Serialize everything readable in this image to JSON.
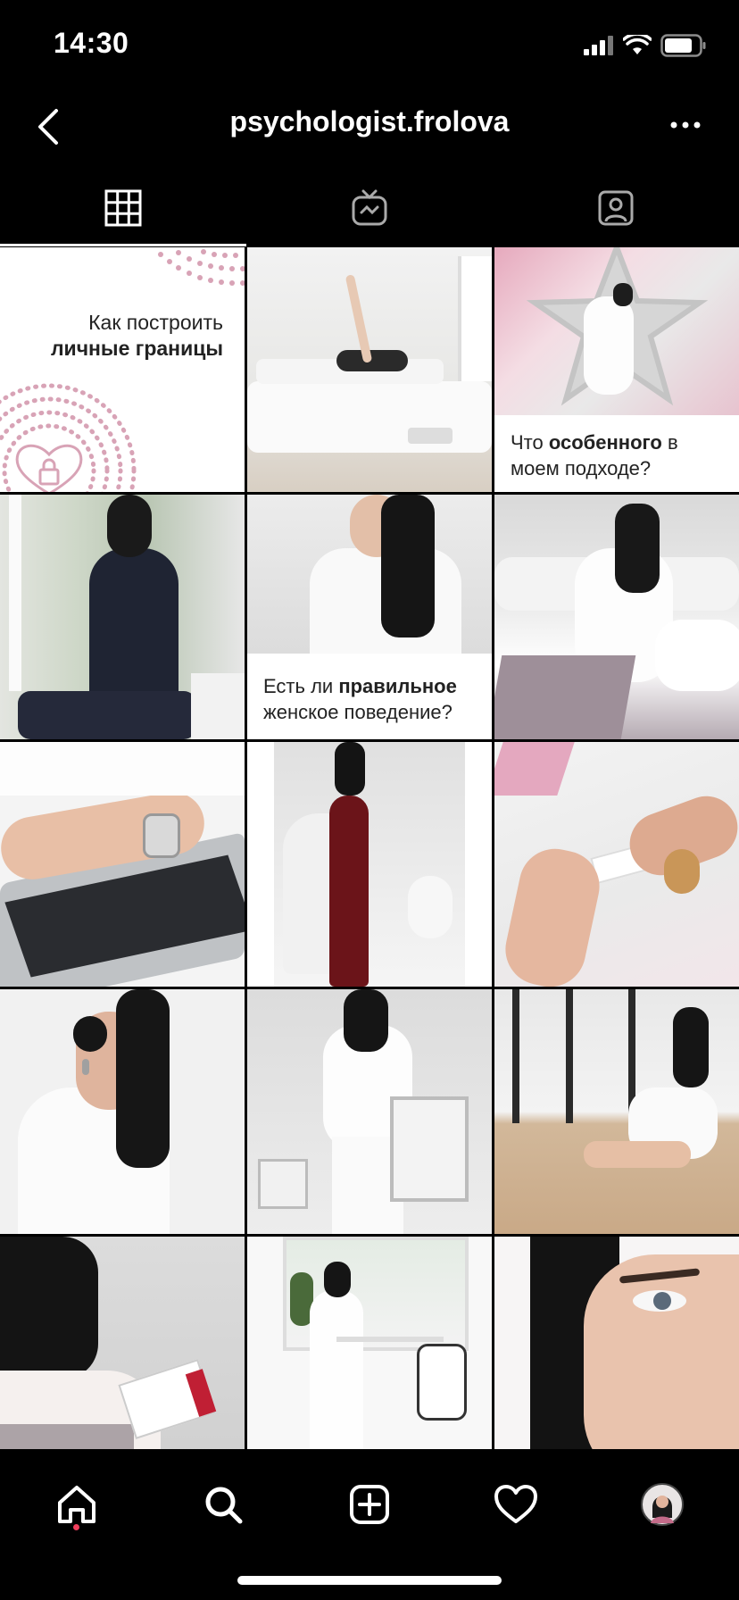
{
  "status": {
    "time": "14:30"
  },
  "header": {
    "title": "psychologist.frolova"
  },
  "tabs": [
    {
      "name": "grid",
      "icon": "grid-icon",
      "active": true
    },
    {
      "name": "igtv",
      "icon": "tv-icon",
      "active": false
    },
    {
      "name": "tagged",
      "icon": "tagged-icon",
      "active": false
    }
  ],
  "posts": [
    {
      "type": "text-card",
      "line1": "Как построить",
      "line2": "личные границы"
    },
    {
      "type": "photo",
      "subject": "woman lying on bed reading"
    },
    {
      "type": "photo-caption",
      "caption_pre": "Что ",
      "caption_bold": "особенного",
      "caption_post": " в",
      "caption_line2": "моем подходе?"
    },
    {
      "type": "photo",
      "subject": "woman in black dress by window"
    },
    {
      "type": "photo-caption",
      "caption_pre": "Есть ли ",
      "caption_bold": "правильное",
      "caption_post": "",
      "caption_line2": "женское поведение?"
    },
    {
      "type": "photo",
      "subject": "woman in white on bed with mug"
    },
    {
      "type": "photo",
      "subject": "hands on laptop with watch"
    },
    {
      "type": "photo",
      "subject": "woman in red velvet dress"
    },
    {
      "type": "photo",
      "subject": "hands opening fortune cookie"
    },
    {
      "type": "photo",
      "subject": "woman portrait with earring"
    },
    {
      "type": "photo",
      "subject": "woman with hands up in white room"
    },
    {
      "type": "photo",
      "subject": "woman sitting on floor"
    },
    {
      "type": "photo",
      "subject": "woman writing in notebook"
    },
    {
      "type": "photo",
      "subject": "woman at white desk"
    },
    {
      "type": "photo",
      "subject": "close-up eye portrait"
    }
  ],
  "bottom_nav": [
    {
      "name": "home",
      "icon": "home-icon"
    },
    {
      "name": "search",
      "icon": "search-icon"
    },
    {
      "name": "create",
      "icon": "add-post-icon"
    },
    {
      "name": "activity",
      "icon": "heart-icon"
    },
    {
      "name": "profile",
      "icon": "avatar"
    }
  ],
  "colors": {
    "accent_dot": "#ef3e5c",
    "pattern": "#d8a3b6"
  }
}
